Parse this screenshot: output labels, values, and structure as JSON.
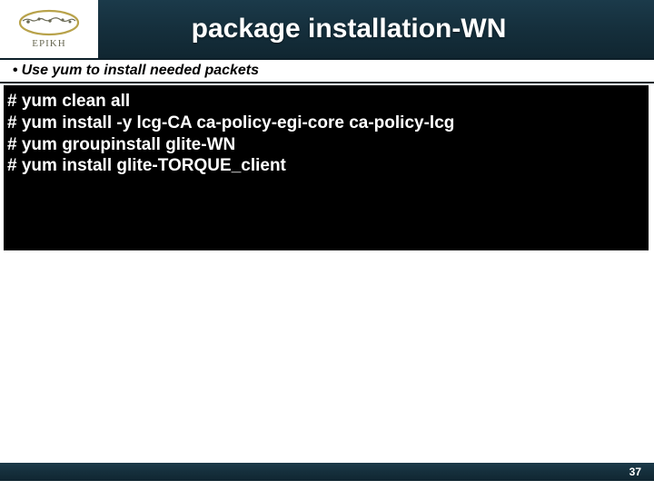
{
  "logo": {
    "text": "EPIKH"
  },
  "header": {
    "title": "package installation-WN"
  },
  "subheader": {
    "bullet": "•",
    "text": "Use yum to install needed packets"
  },
  "terminal": {
    "lines": [
      "# yum clean all",
      "# yum install -y lcg-CA ca-policy-egi-core ca-policy-lcg",
      "# yum groupinstall glite-WN",
      "# yum install glite-TORQUE_client"
    ]
  },
  "footer": {
    "page": "37"
  }
}
